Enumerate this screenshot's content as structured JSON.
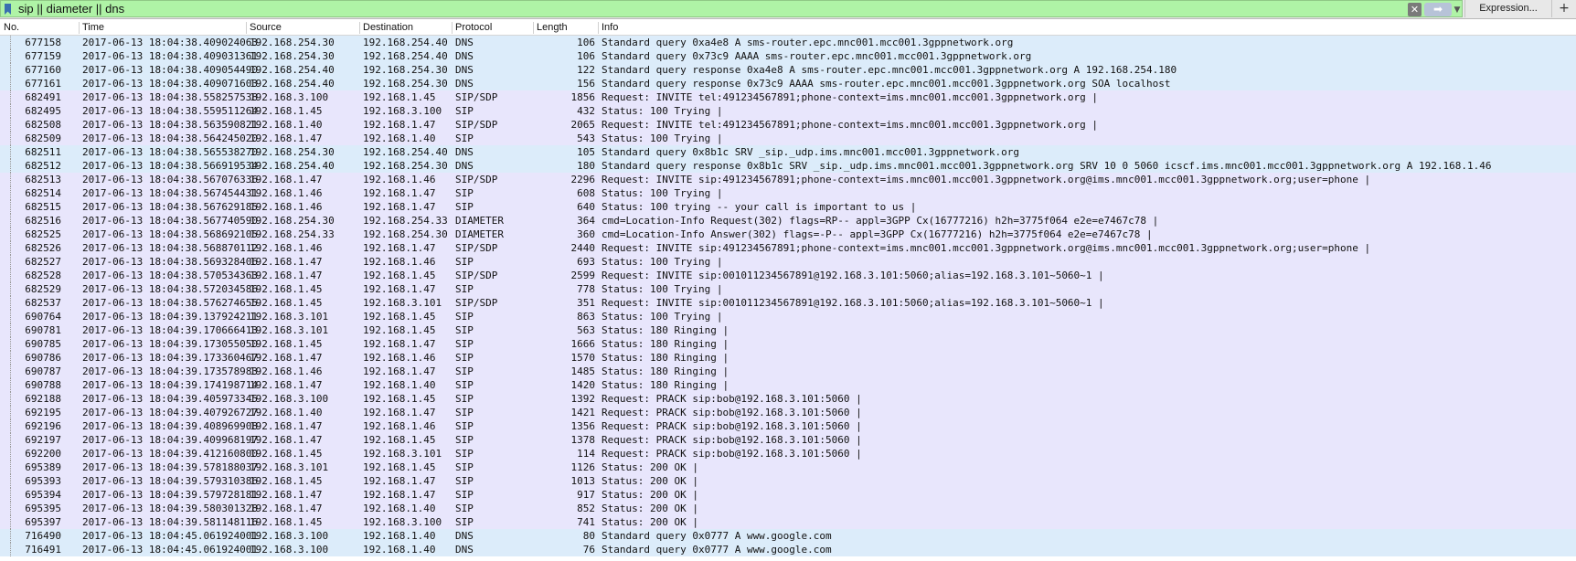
{
  "filter": {
    "text": "sip || diameter || dns",
    "clear_glyph": "✕",
    "apply_glyph": "➡",
    "recent_glyph": "▼",
    "expression_label": "Expression...",
    "add_label": "+"
  },
  "icons": {
    "bookmark": "bookmark-icon",
    "clear": "close-icon",
    "apply": "arrow-right-icon",
    "recent": "chevron-down-icon"
  },
  "columns": [
    "No.",
    "Time",
    "Source",
    "Destination",
    "Protocol",
    "Length",
    "Info"
  ],
  "colors": {
    "dns": "#dcecfa",
    "sip": "#e8e6fc",
    "filter_bg": "#aff3a6"
  },
  "packets": [
    {
      "no": "677158",
      "time": "2017-06-13 18:04:38.409024063",
      "src": "192.168.254.30",
      "dst": "192.168.254.40",
      "proto": "DNS",
      "len": "106",
      "info": "Standard query 0xa4e8 A sms-router.epc.mnc001.mcc001.3gppnetwork.org"
    },
    {
      "no": "677159",
      "time": "2017-06-13 18:04:38.409031361",
      "src": "192.168.254.30",
      "dst": "192.168.254.40",
      "proto": "DNS",
      "len": "106",
      "info": "Standard query 0x73c9 AAAA sms-router.epc.mnc001.mcc001.3gppnetwork.org"
    },
    {
      "no": "677160",
      "time": "2017-06-13 18:04:38.409054490",
      "src": "192.168.254.40",
      "dst": "192.168.254.30",
      "proto": "DNS",
      "len": "122",
      "info": "Standard query response 0xa4e8 A sms-router.epc.mnc001.mcc001.3gppnetwork.org A 192.168.254.180"
    },
    {
      "no": "677161",
      "time": "2017-06-13 18:04:38.409071603",
      "src": "192.168.254.40",
      "dst": "192.168.254.30",
      "proto": "DNS",
      "len": "156",
      "info": "Standard query response 0x73c9 AAAA sms-router.epc.mnc001.mcc001.3gppnetwork.org SOA localhost"
    },
    {
      "no": "682491",
      "time": "2017-06-13 18:04:38.558257538",
      "src": "192.168.3.100",
      "dst": "192.168.1.45",
      "proto": "SIP/SDP",
      "len": "1856",
      "info": "Request: INVITE tel:491234567891;phone-context=ims.mnc001.mcc001.3gppnetwork.org |"
    },
    {
      "no": "682495",
      "time": "2017-06-13 18:04:38.559511264",
      "src": "192.168.1.45",
      "dst": "192.168.3.100",
      "proto": "SIP",
      "len": "432",
      "info": "Status: 100 Trying |"
    },
    {
      "no": "682508",
      "time": "2017-06-13 18:04:38.563590821",
      "src": "192.168.1.40",
      "dst": "192.168.1.47",
      "proto": "SIP/SDP",
      "len": "2065",
      "info": "Request: INVITE tel:491234567891;phone-context=ims.mnc001.mcc001.3gppnetwork.org |"
    },
    {
      "no": "682509",
      "time": "2017-06-13 18:04:38.564245020",
      "src": "192.168.1.47",
      "dst": "192.168.1.40",
      "proto": "SIP",
      "len": "543",
      "info": "Status: 100 Trying |"
    },
    {
      "no": "682511",
      "time": "2017-06-13 18:04:38.565538270",
      "src": "192.168.254.30",
      "dst": "192.168.254.40",
      "proto": "DNS",
      "len": "105",
      "info": "Standard query 0x8b1c SRV _sip._udp.ims.mnc001.mcc001.3gppnetwork.org"
    },
    {
      "no": "682512",
      "time": "2017-06-13 18:04:38.566919534",
      "src": "192.168.254.40",
      "dst": "192.168.254.30",
      "proto": "DNS",
      "len": "180",
      "info": "Standard query response 0x8b1c SRV _sip._udp.ims.mnc001.mcc001.3gppnetwork.org SRV 10 0 5060 icscf.ims.mnc001.mcc001.3gppnetwork.org A 192.168.1.46"
    },
    {
      "no": "682513",
      "time": "2017-06-13 18:04:38.567076336",
      "src": "192.168.1.47",
      "dst": "192.168.1.46",
      "proto": "SIP/SDP",
      "len": "2296",
      "info": "Request: INVITE sip:491234567891;phone-context=ims.mnc001.mcc001.3gppnetwork.org@ims.mnc001.mcc001.3gppnetwork.org;user=phone |"
    },
    {
      "no": "682514",
      "time": "2017-06-13 18:04:38.567454431",
      "src": "192.168.1.46",
      "dst": "192.168.1.47",
      "proto": "SIP",
      "len": "608",
      "info": "Status: 100 Trying |"
    },
    {
      "no": "682515",
      "time": "2017-06-13 18:04:38.567629185",
      "src": "192.168.1.46",
      "dst": "192.168.1.47",
      "proto": "SIP",
      "len": "640",
      "info": "Status: 100 trying -- your call is important to us |"
    },
    {
      "no": "682516",
      "time": "2017-06-13 18:04:38.567740590",
      "src": "192.168.254.30",
      "dst": "192.168.254.33",
      "proto": "DIAMETER",
      "len": "364",
      "info": "cmd=Location-Info Request(302) flags=RP-- appl=3GPP Cx(16777216) h2h=3775f064 e2e=e7467c78 |"
    },
    {
      "no": "682525",
      "time": "2017-06-13 18:04:38.568692105",
      "src": "192.168.254.33",
      "dst": "192.168.254.30",
      "proto": "DIAMETER",
      "len": "360",
      "info": "cmd=Location-Info Answer(302) flags=-P-- appl=3GPP Cx(16777216) h2h=3775f064 e2e=e7467c78 |"
    },
    {
      "no": "682526",
      "time": "2017-06-13 18:04:38.568870112",
      "src": "192.168.1.46",
      "dst": "192.168.1.47",
      "proto": "SIP/SDP",
      "len": "2440",
      "info": "Request: INVITE sip:491234567891;phone-context=ims.mnc001.mcc001.3gppnetwork.org@ims.mnc001.mcc001.3gppnetwork.org;user=phone |"
    },
    {
      "no": "682527",
      "time": "2017-06-13 18:04:38.569328406",
      "src": "192.168.1.47",
      "dst": "192.168.1.46",
      "proto": "SIP",
      "len": "693",
      "info": "Status: 100 Trying |"
    },
    {
      "no": "682528",
      "time": "2017-06-13 18:04:38.570534363",
      "src": "192.168.1.47",
      "dst": "192.168.1.45",
      "proto": "SIP/SDP",
      "len": "2599",
      "info": "Request: INVITE sip:001011234567891@192.168.3.101:5060;alias=192.168.3.101~5060~1 |"
    },
    {
      "no": "682529",
      "time": "2017-06-13 18:04:38.572034586",
      "src": "192.168.1.45",
      "dst": "192.168.1.47",
      "proto": "SIP",
      "len": "778",
      "info": "Status: 100 Trying |"
    },
    {
      "no": "682537",
      "time": "2017-06-13 18:04:38.576274655",
      "src": "192.168.1.45",
      "dst": "192.168.3.101",
      "proto": "SIP/SDP",
      "len": "351",
      "info": "Request: INVITE sip:001011234567891@192.168.3.101:5060;alias=192.168.3.101~5060~1 |"
    },
    {
      "no": "690764",
      "time": "2017-06-13 18:04:39.137924211",
      "src": "192.168.3.101",
      "dst": "192.168.1.45",
      "proto": "SIP",
      "len": "863",
      "info": "Status: 100 Trying |"
    },
    {
      "no": "690781",
      "time": "2017-06-13 18:04:39.170666413",
      "src": "192.168.3.101",
      "dst": "192.168.1.45",
      "proto": "SIP",
      "len": "563",
      "info": "Status: 180 Ringing |"
    },
    {
      "no": "690785",
      "time": "2017-06-13 18:04:39.173055050",
      "src": "192.168.1.45",
      "dst": "192.168.1.47",
      "proto": "SIP",
      "len": "1666",
      "info": "Status: 180 Ringing |"
    },
    {
      "no": "690786",
      "time": "2017-06-13 18:04:39.173360467",
      "src": "192.168.1.47",
      "dst": "192.168.1.46",
      "proto": "SIP",
      "len": "1570",
      "info": "Status: 180 Ringing |"
    },
    {
      "no": "690787",
      "time": "2017-06-13 18:04:39.173578983",
      "src": "192.168.1.46",
      "dst": "192.168.1.47",
      "proto": "SIP",
      "len": "1485",
      "info": "Status: 180 Ringing |"
    },
    {
      "no": "690788",
      "time": "2017-06-13 18:04:39.174198714",
      "src": "192.168.1.47",
      "dst": "192.168.1.40",
      "proto": "SIP",
      "len": "1420",
      "info": "Status: 180 Ringing |"
    },
    {
      "no": "692188",
      "time": "2017-06-13 18:04:39.405973345",
      "src": "192.168.3.100",
      "dst": "192.168.1.45",
      "proto": "SIP",
      "len": "1392",
      "info": "Request: PRACK sip:bob@192.168.3.101:5060 |"
    },
    {
      "no": "692195",
      "time": "2017-06-13 18:04:39.407926727",
      "src": "192.168.1.40",
      "dst": "192.168.1.47",
      "proto": "SIP",
      "len": "1421",
      "info": "Request: PRACK sip:bob@192.168.3.101:5060 |"
    },
    {
      "no": "692196",
      "time": "2017-06-13 18:04:39.408969908",
      "src": "192.168.1.47",
      "dst": "192.168.1.46",
      "proto": "SIP",
      "len": "1356",
      "info": "Request: PRACK sip:bob@192.168.3.101:5060 |"
    },
    {
      "no": "692197",
      "time": "2017-06-13 18:04:39.409968197",
      "src": "192.168.1.47",
      "dst": "192.168.1.45",
      "proto": "SIP",
      "len": "1378",
      "info": "Request: PRACK sip:bob@192.168.3.101:5060 |"
    },
    {
      "no": "692200",
      "time": "2017-06-13 18:04:39.412160800",
      "src": "192.168.1.45",
      "dst": "192.168.3.101",
      "proto": "SIP",
      "len": "114",
      "info": "Request: PRACK sip:bob@192.168.3.101:5060 |"
    },
    {
      "no": "695389",
      "time": "2017-06-13 18:04:39.578188037",
      "src": "192.168.3.101",
      "dst": "192.168.1.45",
      "proto": "SIP",
      "len": "1126",
      "info": "Status: 200 OK |"
    },
    {
      "no": "695393",
      "time": "2017-06-13 18:04:39.579310386",
      "src": "192.168.1.45",
      "dst": "192.168.1.47",
      "proto": "SIP",
      "len": "1013",
      "info": "Status: 200 OK |"
    },
    {
      "no": "695394",
      "time": "2017-06-13 18:04:39.579728181",
      "src": "192.168.1.47",
      "dst": "192.168.1.47",
      "proto": "SIP",
      "len": "917",
      "info": "Status: 200 OK |"
    },
    {
      "no": "695395",
      "time": "2017-06-13 18:04:39.580301328",
      "src": "192.168.1.47",
      "dst": "192.168.1.40",
      "proto": "SIP",
      "len": "852",
      "info": "Status: 200 OK |"
    },
    {
      "no": "695397",
      "time": "2017-06-13 18:04:39.581148116",
      "src": "192.168.1.45",
      "dst": "192.168.3.100",
      "proto": "SIP",
      "len": "741",
      "info": "Status: 200 OK |"
    },
    {
      "no": "716490",
      "time": "2017-06-13 18:04:45.061924001",
      "src": "192.168.3.100",
      "dst": "192.168.1.40",
      "proto": "DNS",
      "len": "80",
      "info": "Standard query 0x0777 A www.google.com"
    },
    {
      "no": "716491",
      "time": "2017-06-13 18:04:45.061924001",
      "src": "192.168.3.100",
      "dst": "192.168.1.40",
      "proto": "DNS",
      "len": "76",
      "info": "Standard query 0x0777 A www.google.com"
    }
  ]
}
